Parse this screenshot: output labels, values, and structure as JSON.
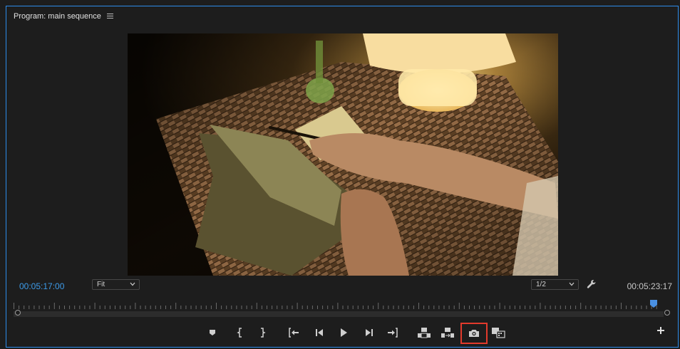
{
  "panel": {
    "title": "Program: main sequence",
    "menu_icon": "hamburger-menu-icon"
  },
  "timecodes": {
    "current": "00:05:17:00",
    "duration": "00:05:23:17"
  },
  "zoom": {
    "selected": "Fit"
  },
  "resolution": {
    "selected": "1/2"
  },
  "playhead": {
    "position_fraction": 0.985
  },
  "transport": [
    {
      "name": "add-marker-button",
      "icon": "marker-icon"
    },
    {
      "name": "mark-in-button",
      "icon": "mark-in-icon"
    },
    {
      "name": "mark-out-button",
      "icon": "mark-out-icon"
    },
    {
      "name": "go-to-in-button",
      "icon": "go-to-in-icon"
    },
    {
      "name": "step-back-button",
      "icon": "step-back-icon"
    },
    {
      "name": "play-button",
      "icon": "play-icon"
    },
    {
      "name": "step-forward-button",
      "icon": "step-forward-icon"
    },
    {
      "name": "go-to-out-button",
      "icon": "go-to-out-icon"
    },
    {
      "name": "lift-button",
      "icon": "lift-icon"
    },
    {
      "name": "extract-button",
      "icon": "extract-icon"
    },
    {
      "name": "export-frame-button",
      "icon": "camera-icon",
      "highlighted": true
    },
    {
      "name": "comparison-view-button",
      "icon": "comparison-view-icon"
    }
  ],
  "colors": {
    "accent": "#2d8ceb",
    "timecode_current": "#3d9be9",
    "highlight": "#e23a2c",
    "playhead": "#4a90e2"
  }
}
